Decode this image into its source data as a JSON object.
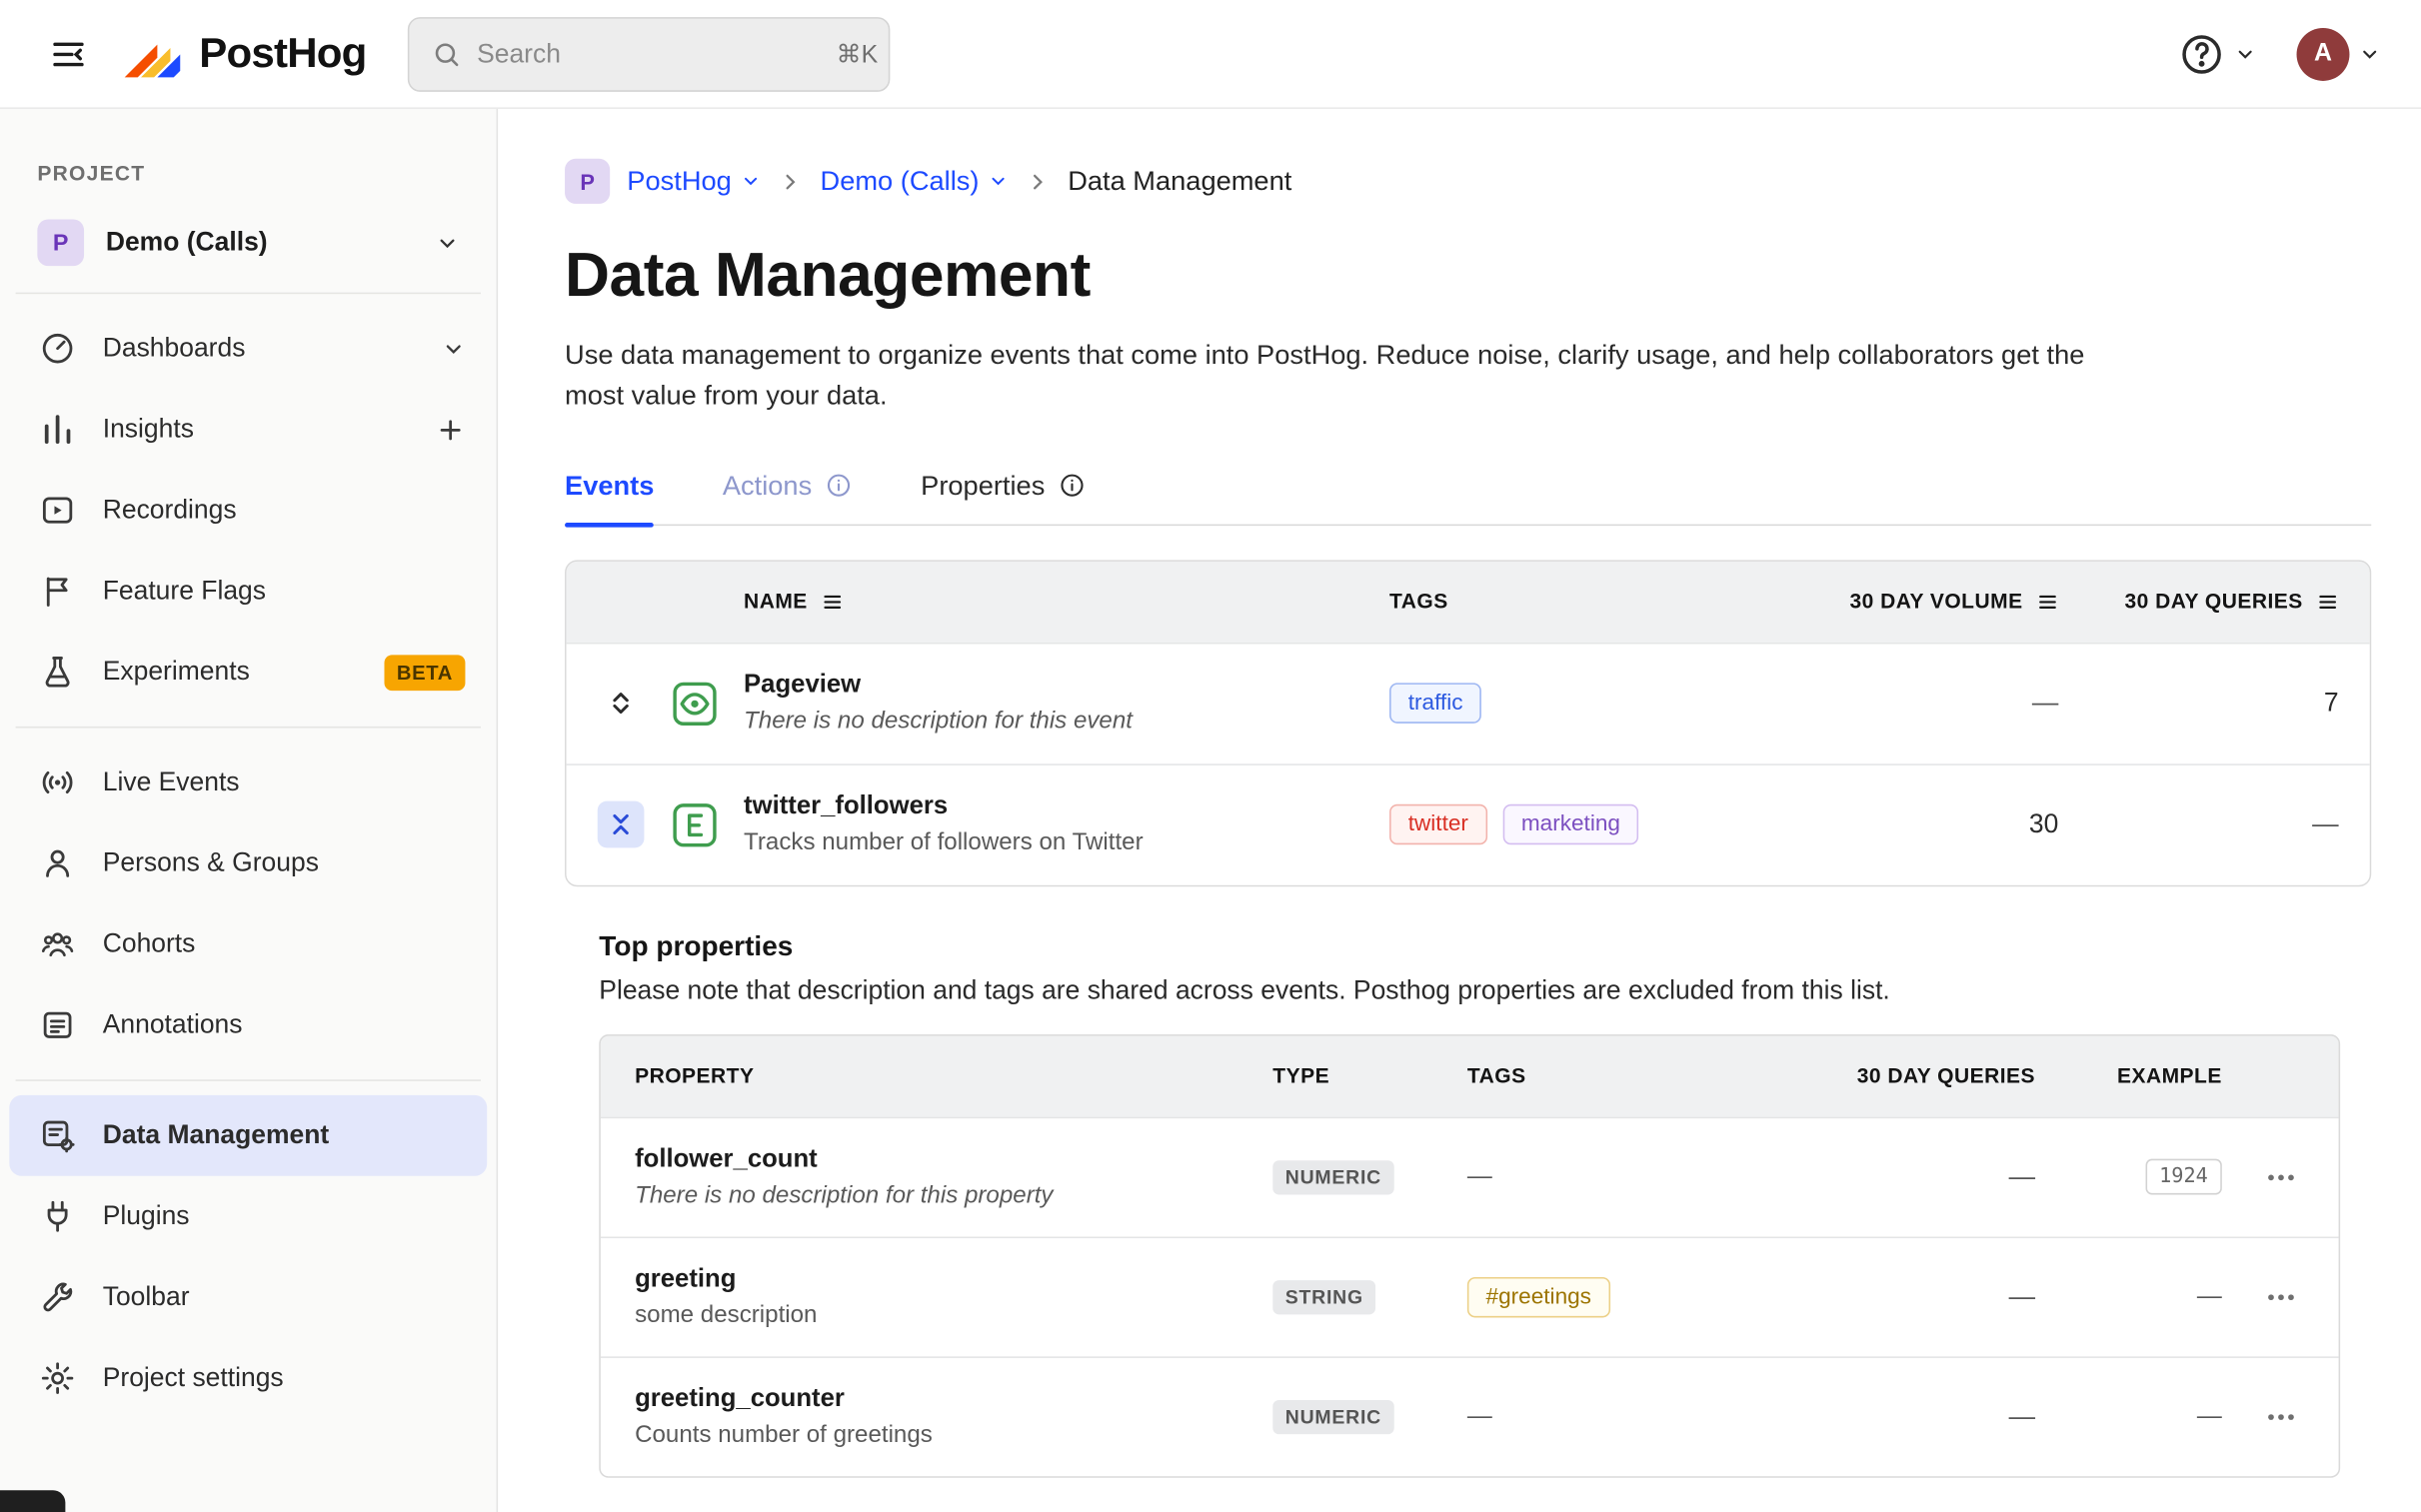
{
  "colors": {
    "accent": "#1d4aff",
    "sidebar-active-bg": "#e3e7fb",
    "beta-badge-bg": "#f7a501",
    "beta-badge-text": "#4a3500",
    "avatar-bg": "#8f3b3b",
    "project-avatar-bg": "#e2d8f3",
    "project-avatar-text": "#6a35b8",
    "event-icon-green": "#3f9d4e",
    "tag-blue": "#2d5ae0",
    "tag-red": "#d93025",
    "tag-purple": "#7c4fc0",
    "tag-yellow": "#9c7400"
  },
  "topbar": {
    "logo_text": "PostHog",
    "search": {
      "placeholder": "Search",
      "shortcut": "⌘K"
    },
    "avatar_letter": "A"
  },
  "sidebar": {
    "section_label": "PROJECT",
    "project": {
      "initial": "P",
      "name": "Demo (Calls)"
    },
    "groups": [
      {
        "items": [
          {
            "label": "Dashboards"
          },
          {
            "label": "Insights"
          },
          {
            "label": "Recordings"
          },
          {
            "label": "Feature Flags"
          },
          {
            "label": "Experiments",
            "badge": "BETA"
          }
        ]
      },
      {
        "items": [
          {
            "label": "Live Events"
          },
          {
            "label": "Persons & Groups"
          },
          {
            "label": "Cohorts"
          },
          {
            "label": "Annotations"
          }
        ]
      },
      {
        "items": [
          {
            "label": "Data Management"
          },
          {
            "label": "Plugins"
          },
          {
            "label": "Toolbar"
          },
          {
            "label": "Project settings"
          }
        ]
      }
    ]
  },
  "breadcrumb": {
    "project_initial": "P",
    "items": [
      "PostHog",
      "Demo (Calls)",
      "Data Management"
    ]
  },
  "page": {
    "title": "Data Management",
    "description": "Use data management to organize events that come into PostHog. Reduce noise, clarify usage, and help collaborators get the most value from your data."
  },
  "tabs": [
    {
      "label": "Events"
    },
    {
      "label": "Actions"
    },
    {
      "label": "Properties"
    }
  ],
  "events_table": {
    "headers": [
      "NAME",
      "TAGS",
      "30 DAY VOLUME",
      "30 DAY QUERIES"
    ],
    "rows": [
      {
        "name": "Pageview",
        "description": "There is no description for this event",
        "tags": [
          {
            "label": "traffic"
          }
        ],
        "volume": "—",
        "queries": "7"
      },
      {
        "name": "twitter_followers",
        "description": "Tracks number of followers on Twitter",
        "tags": [
          {
            "label": "twitter"
          },
          {
            "label": "marketing"
          }
        ],
        "volume": "30",
        "queries": "—"
      }
    ]
  },
  "top_properties": {
    "title": "Top properties",
    "note": "Please note that description and tags are shared across events. Posthog properties are excluded from this list.",
    "headers": [
      "PROPERTY",
      "TYPE",
      "TAGS",
      "30 DAY QUERIES",
      "EXAMPLE"
    ],
    "rows": [
      {
        "name": "follower_count",
        "description": "There is no description for this property",
        "type": "NUMERIC",
        "tags": "—",
        "queries": "—",
        "example": "1924"
      },
      {
        "name": "greeting",
        "description": "some description",
        "type": "STRING",
        "tag": "#greetings",
        "queries": "—",
        "example": "—"
      },
      {
        "name": "greeting_counter",
        "description": "Counts number of greetings",
        "type": "NUMERIC",
        "tags": "—",
        "queries": "—",
        "example": "—"
      }
    ]
  }
}
